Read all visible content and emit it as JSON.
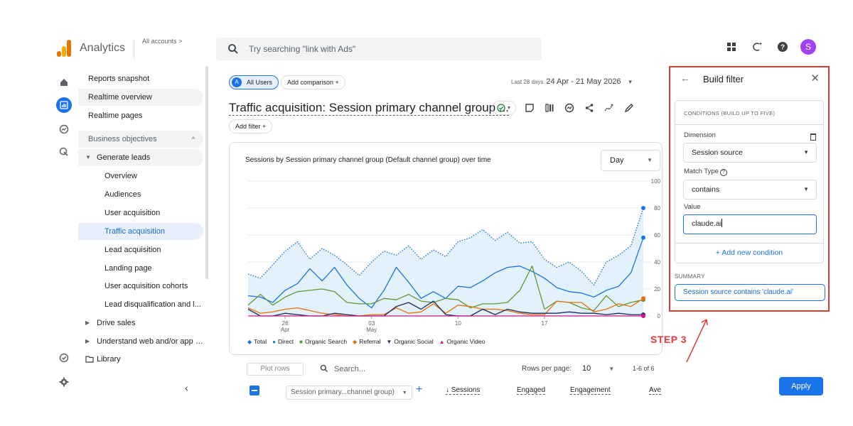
{
  "header": {
    "app_title": "Analytics",
    "accounts_label": "All accounts >",
    "search_placeholder": "Try searching \"link with Ads\"",
    "avatar_letter": "S"
  },
  "nav": {
    "items": [
      {
        "label": "Reports snapshot",
        "type": "item"
      },
      {
        "label": "Realtime overview",
        "type": "item-hl"
      },
      {
        "label": "Realtime pages",
        "type": "item"
      },
      {
        "label": "Business objectives",
        "type": "section"
      },
      {
        "label": "Generate leads",
        "type": "caret-open"
      },
      {
        "label": "Overview",
        "type": "sub"
      },
      {
        "label": "Audiences",
        "type": "sub"
      },
      {
        "label": "User acquisition",
        "type": "sub"
      },
      {
        "label": "Traffic acquisition",
        "type": "sub-active"
      },
      {
        "label": "Lead acquisition",
        "type": "sub"
      },
      {
        "label": "Landing page",
        "type": "sub"
      },
      {
        "label": "User acquisition cohorts",
        "type": "sub"
      },
      {
        "label": "Lead disqualification and l...",
        "type": "sub"
      },
      {
        "label": "Drive sales",
        "type": "caret"
      },
      {
        "label": "Understand web and/or app t...",
        "type": "caret"
      },
      {
        "label": "Library",
        "type": "library"
      }
    ]
  },
  "report": {
    "segment_badge": "A",
    "segment_label": "All Users",
    "add_comparison": "Add comparison +",
    "date_prefix": "Last 28 days",
    "date_range": "24 Apr - 21 May 2026",
    "title": "Traffic acquisition: Session primary channel group ...",
    "add_filter": "Add filter +"
  },
  "chart_data": {
    "type": "line",
    "title": "Sessions by Session primary channel group (Default channel group) over time",
    "granularity": "Day",
    "ylim": [
      0,
      100
    ],
    "y_ticks": [
      0,
      20,
      40,
      60,
      80,
      100
    ],
    "x_tick_labels": [
      {
        "day": 3,
        "line1": "26",
        "line2": "Apr"
      },
      {
        "day": 10,
        "line1": "03",
        "line2": "May"
      },
      {
        "day": 17,
        "line1": "10",
        "line2": ""
      },
      {
        "day": 24,
        "line1": "17",
        "line2": ""
      }
    ],
    "series": [
      {
        "name": "Total",
        "color": "#1a73e8",
        "dotted": true,
        "values": [
          31,
          28,
          38,
          48,
          55,
          42,
          50,
          45,
          38,
          30,
          40,
          48,
          45,
          52,
          42,
          49,
          44,
          55,
          58,
          64,
          56,
          62,
          54,
          55,
          42,
          36,
          40,
          33,
          23,
          40,
          45,
          52,
          80
        ]
      },
      {
        "name": "Direct",
        "color": "#1a73e8",
        "values": [
          15,
          14,
          10,
          19,
          24,
          35,
          26,
          36,
          23,
          13,
          6,
          19,
          36,
          25,
          13,
          18,
          13,
          22,
          21,
          26,
          32,
          36,
          37,
          33,
          28,
          21,
          18,
          17,
          14,
          19,
          22,
          32,
          58
        ]
      },
      {
        "name": "Organic Search",
        "color": "#5e9a35",
        "values": [
          8,
          16,
          8,
          14,
          18,
          19,
          20,
          18,
          10,
          9,
          9,
          13,
          12,
          16,
          11,
          10,
          13,
          12,
          6,
          9,
          9,
          10,
          19,
          37,
          5,
          11,
          10,
          6,
          4,
          15,
          7,
          10,
          12
        ]
      },
      {
        "name": "Referral",
        "color": "#e8710a",
        "values": [
          6,
          2,
          3,
          5,
          6,
          4,
          2,
          1,
          0,
          0,
          1,
          1,
          6,
          2,
          3,
          9,
          2,
          8,
          7,
          5,
          5,
          4,
          2,
          1,
          1,
          11,
          10,
          10,
          3,
          5,
          9,
          7,
          13
        ]
      },
      {
        "name": "Organic Social",
        "color": "#202b65",
        "values": [
          5,
          0,
          0,
          2,
          1,
          0,
          0,
          2,
          1,
          0,
          0,
          0,
          7,
          10,
          5,
          11,
          1,
          0,
          0,
          5,
          1,
          5,
          3,
          2,
          2,
          2,
          3,
          2,
          2,
          1,
          2,
          1,
          1
        ]
      },
      {
        "name": "Organic Video",
        "color": "#d01884",
        "values": [
          0,
          0,
          0,
          0,
          0,
          0,
          0,
          0,
          0,
          0,
          0,
          0,
          0,
          0,
          0,
          0,
          0,
          0,
          0,
          0,
          0,
          0,
          0,
          0,
          0,
          0,
          0,
          0,
          0,
          0,
          0,
          0,
          0
        ]
      }
    ],
    "legend": [
      "Total",
      "Direct",
      "Organic Search",
      "Referral",
      "Organic Social",
      "Organic Video"
    ]
  },
  "table": {
    "plot_rows": "Plot rows",
    "search_placeholder": "Search...",
    "rows_per_page_label": "Rows per page:",
    "rows_per_page_value": "10",
    "pager": "1-6 of 6",
    "dimension": "Session primary...channel group)",
    "columns": [
      "Sessions",
      "Engaged",
      "Engagement",
      "Ave"
    ]
  },
  "filter_panel": {
    "title": "Build filter",
    "conditions_header": "CONDITIONS (BUILD UP TO FIVE)",
    "dimension_label": "Dimension",
    "dimension_value": "Session source",
    "match_type_label": "Match Type",
    "match_type_value": "contains",
    "value_label": "Value",
    "value_input": "claude.ai",
    "add_condition": "+ Add new condition",
    "summary_label": "SUMMARY",
    "summary_text": "Session source contains 'claude.ai'",
    "apply_label": "Apply"
  },
  "annotation": {
    "step_label": "STEP 3",
    "color": "#e53935"
  }
}
